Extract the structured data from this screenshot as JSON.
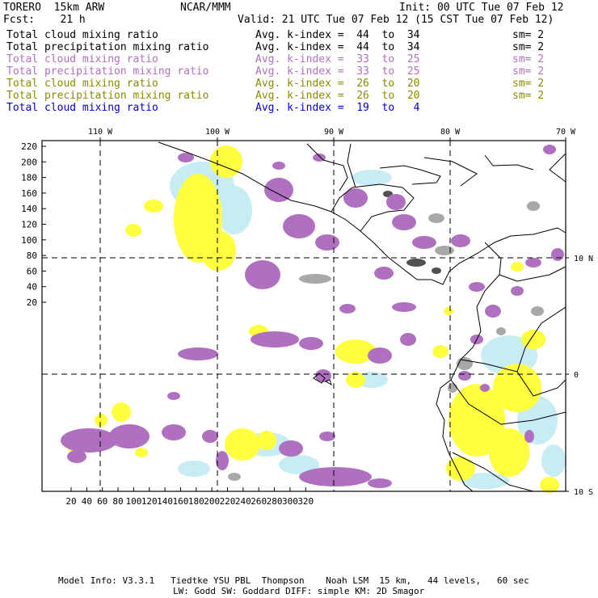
{
  "header": {
    "model": "TORERO  15km ARW",
    "org": "NCAR/MMM",
    "init": "Init: 00 UTC Tue 07 Feb 12",
    "fcst": "Fcst:    21 h",
    "valid": "Valid: 21 UTC Tue 07 Feb 12 (15 CST Tue 07 Feb 12)"
  },
  "legend": [
    {
      "name": "Total cloud mixing ratio",
      "kindex": "Avg. k-index =  44  to  34",
      "sm": "sm= 2",
      "color": "#000000"
    },
    {
      "name": "Total precipitation mixing ratio",
      "kindex": "Avg. k-index =  44  to  34",
      "sm": "sm= 2",
      "color": "#000000"
    },
    {
      "name": "Total cloud mixing ratio",
      "kindex": "Avg. k-index =  33  to  25",
      "sm": "sm= 2",
      "color": "#b070c0"
    },
    {
      "name": "Total precipitation mixing ratio",
      "kindex": "Avg. k-index =  33  to  25",
      "sm": "sm= 2",
      "color": "#b070c0"
    },
    {
      "name": "Total cloud mixing ratio",
      "kindex": "Avg. k-index =  26  to  20",
      "sm": "sm= 2",
      "color": "#8a8a00"
    },
    {
      "name": "Total precipitation mixing ratio",
      "kindex": "Avg. k-index =  26  to  20",
      "sm": "sm= 2",
      "color": "#8a8a00"
    },
    {
      "name": "Total cloud mixing ratio",
      "kindex": "Avg. k-index =  19  to   4",
      "sm": "",
      "color": "#0000cc"
    }
  ],
  "map": {
    "lon_labels": [
      "110 W",
      "100 W",
      "90 W",
      "80 W",
      "70 W"
    ],
    "lat_labels": [
      "10 N",
      "0",
      "10 S"
    ],
    "y_ticks": [
      "220",
      "200",
      "180",
      "160",
      "140",
      "120",
      "100",
      "80",
      "60",
      "40",
      "20"
    ],
    "x_ticks": [
      "20",
      "40",
      "60",
      "80",
      "100",
      "120",
      "140",
      "160",
      "180",
      "200",
      "220",
      "240",
      "260",
      "280",
      "300",
      "320"
    ],
    "colors": {
      "gray": "#a8a8a8",
      "purple": "#b070c0",
      "yellow": "#ffff40",
      "cyan": "#c8ecf4",
      "dark": "#505050"
    }
  },
  "footer": {
    "line1": "Model Info: V3.3.1   Tiedtke YSU PBL  Thompson    Noah LSM  15 km,   44 levels,   60 sec",
    "line2": "LW: Godd SW: Goddard DIFF: simple KM: 2D Smagor"
  }
}
